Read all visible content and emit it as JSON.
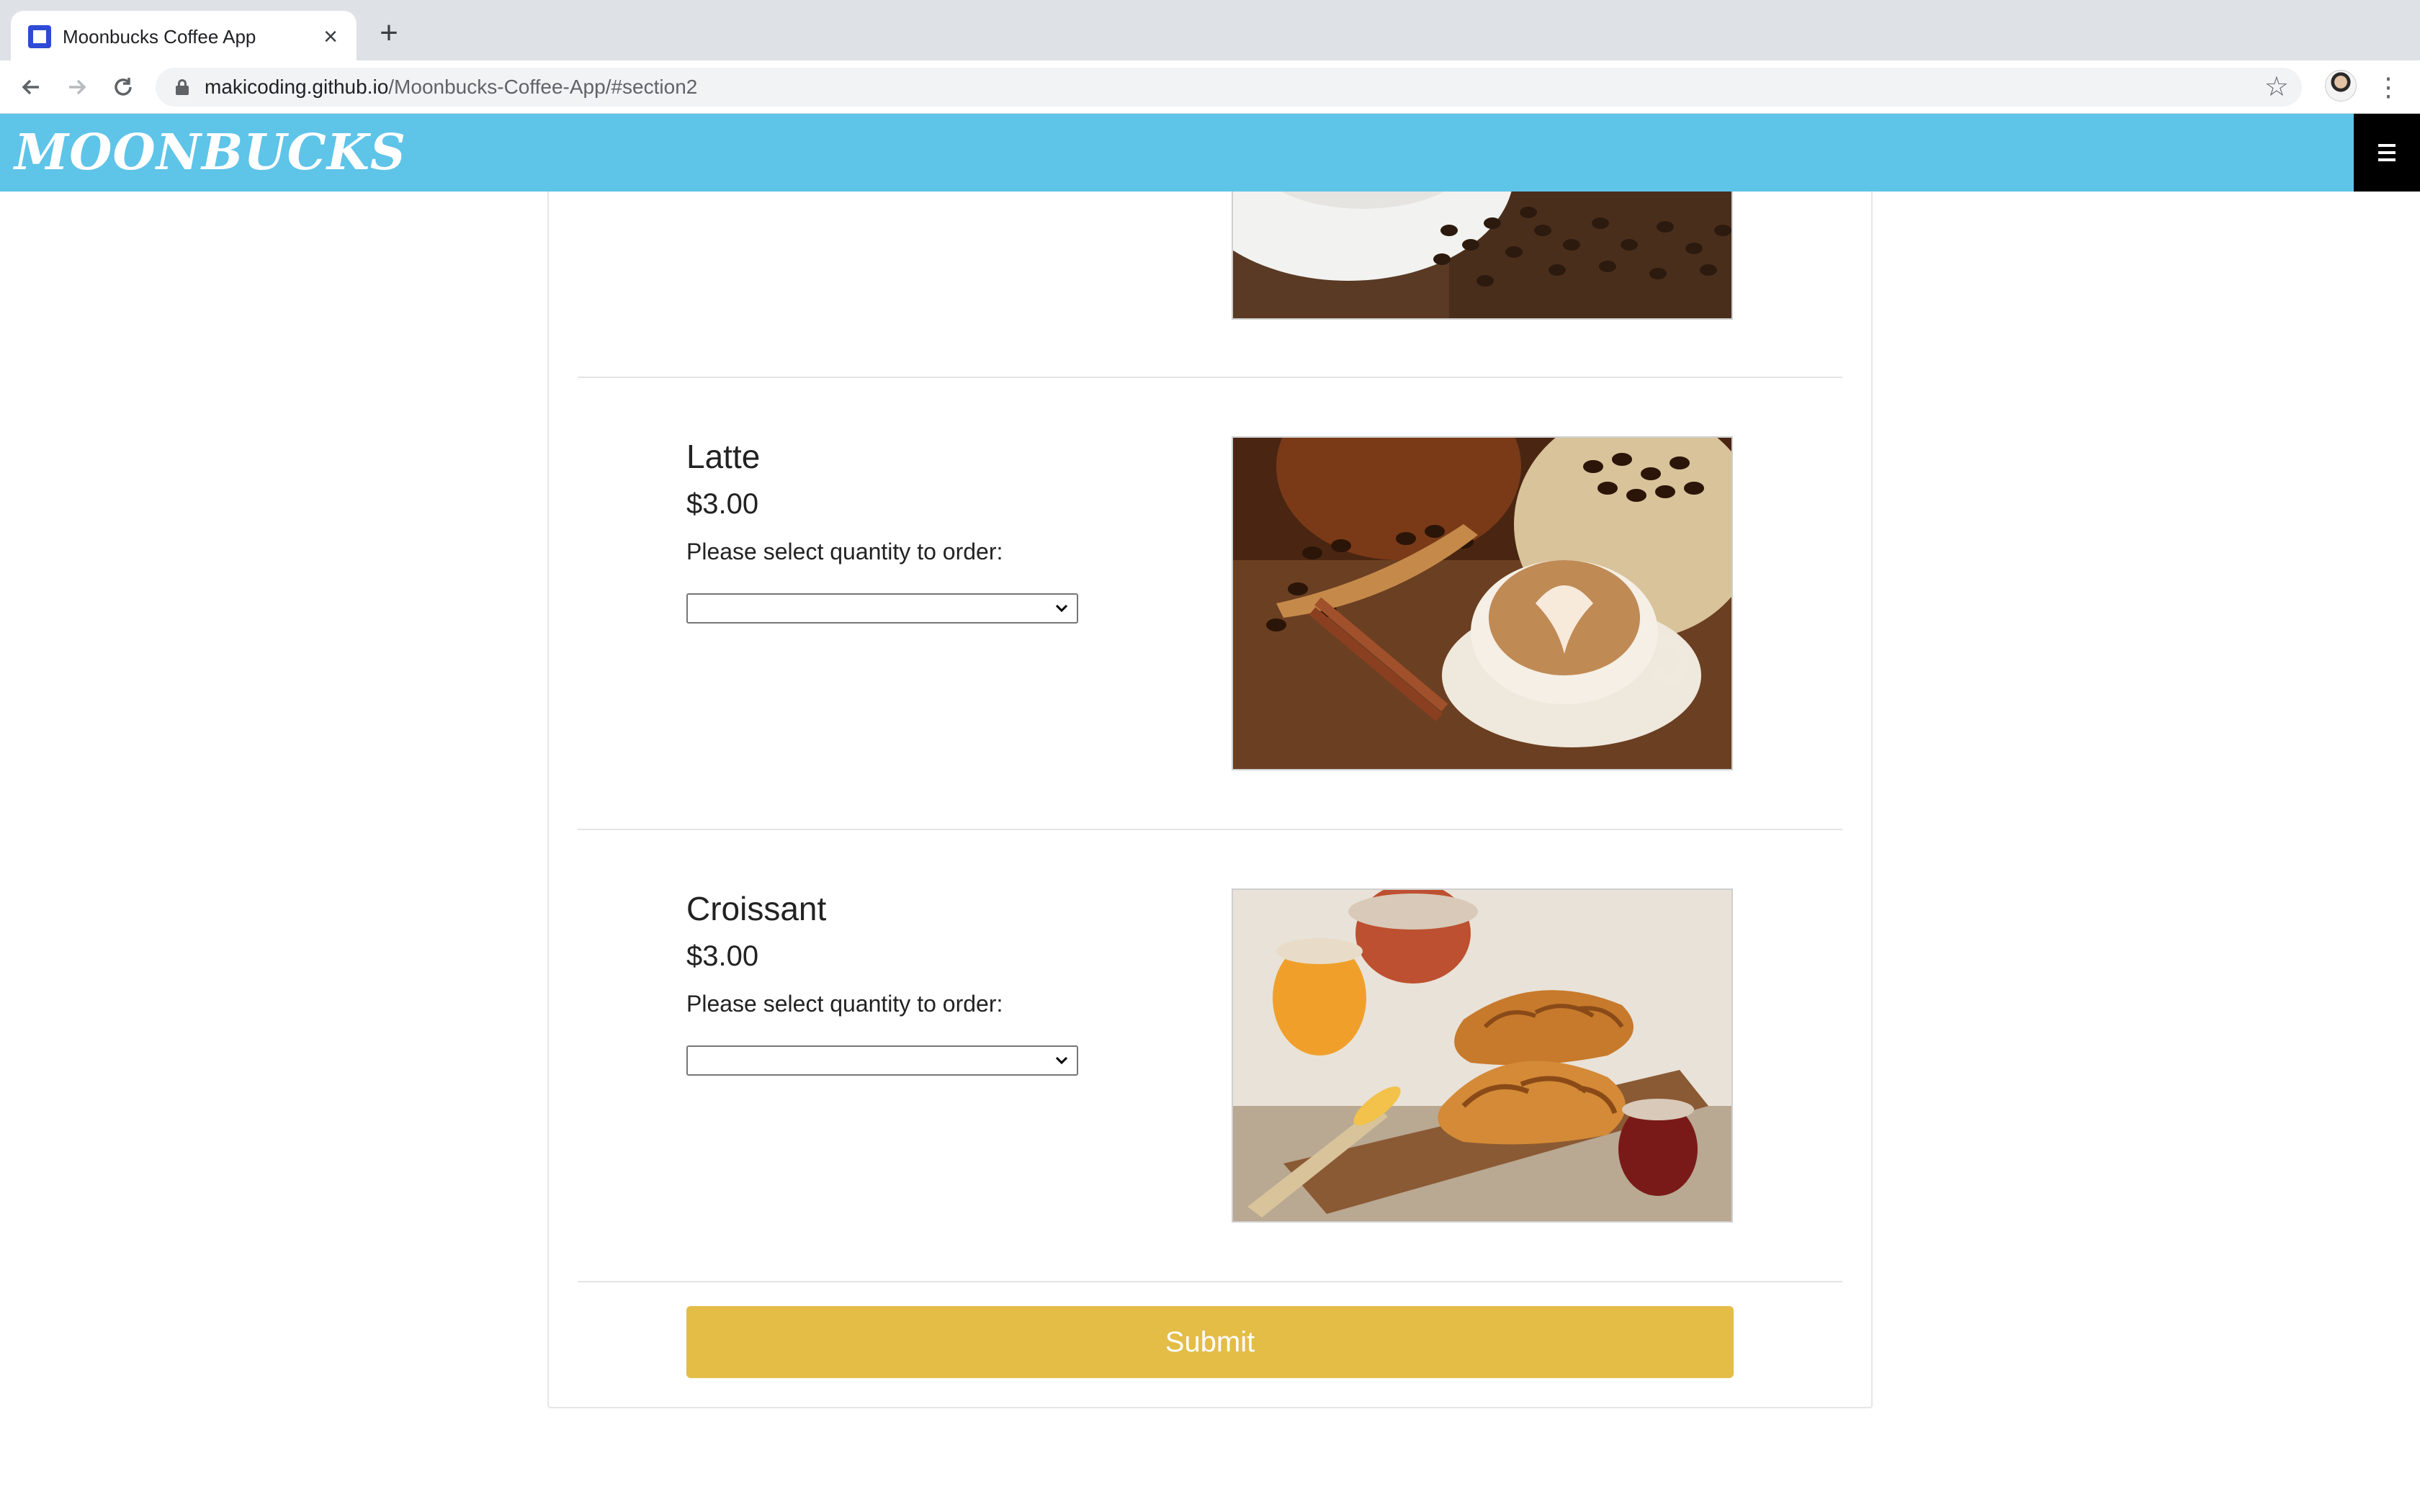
{
  "browser": {
    "tab_title": "Moonbucks Coffee App",
    "url_host": "makicoding.github.io",
    "url_path": "/Moonbucks-Coffee-App/#section2"
  },
  "site": {
    "brand": "MOONBUCKS",
    "brand_color": "#5ec4e8"
  },
  "items": [
    {
      "name": "Latte",
      "price": "$3.00",
      "prompt": "Please select quantity to order:",
      "selected_quantity": ""
    },
    {
      "name": "Croissant",
      "price": "$3.00",
      "prompt": "Please select quantity to order:",
      "selected_quantity": ""
    }
  ],
  "submit_label": "Submit",
  "submit_color": "#e3bd46"
}
